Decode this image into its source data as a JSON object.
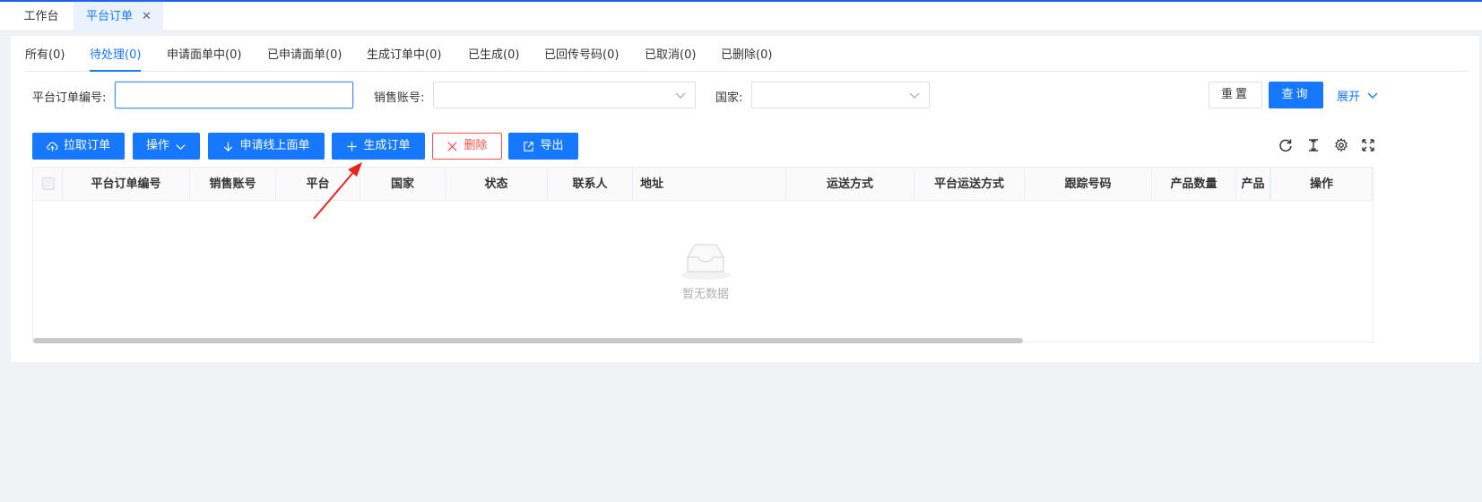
{
  "page_tabs": [
    {
      "label": "工作台"
    },
    {
      "label": "平台订单",
      "close": "✕"
    }
  ],
  "status_tabs": [
    {
      "label": "所有(0)"
    },
    {
      "label": "待处理(0)",
      "active": true
    },
    {
      "label": "申请面单中(0)"
    },
    {
      "label": "已申请面单(0)"
    },
    {
      "label": "生成订单中(0)"
    },
    {
      "label": "已生成(0)"
    },
    {
      "label": "已回传号码(0)"
    },
    {
      "label": "已取消(0)"
    },
    {
      "label": "已删除(0)"
    }
  ],
  "filters": {
    "order_no_label": "平台订单编号:",
    "order_no_value": "",
    "account_label": "销售账号:",
    "account_value": "",
    "country_label": "国家:",
    "country_value": ""
  },
  "search_actions": {
    "reset": "重置",
    "query": "查询",
    "expand": "展开"
  },
  "toolbar": {
    "pull_orders": "拉取订单",
    "operate": "操作",
    "apply_label": "申请线上面单",
    "generate_order": "生成订单",
    "delete": "删除",
    "export": "导出"
  },
  "table": {
    "columns": [
      "平台订单编号",
      "销售账号",
      "平台",
      "国家",
      "状态",
      "联系人",
      "地址",
      "运送方式",
      "平台运送方式",
      "跟踪号码",
      "产品数量",
      "产品",
      "操作"
    ],
    "rows": [],
    "empty_text": "暂无数据"
  },
  "colors": {
    "primary": "#1677ff",
    "danger": "#ff4d4f",
    "top_accent": "#1e62f0",
    "annotation": "#e8251b"
  },
  "icons": {
    "pull_orders": "cloud-upload-icon",
    "operate": "chevron-down-icon",
    "apply_label": "arrow-down-icon",
    "generate_order": "plus-icon",
    "delete": "close-icon",
    "export": "export-icon",
    "refresh": "refresh-icon",
    "column_height": "column-height-icon",
    "settings": "gear-icon",
    "fullscreen": "fullscreen-icon"
  }
}
